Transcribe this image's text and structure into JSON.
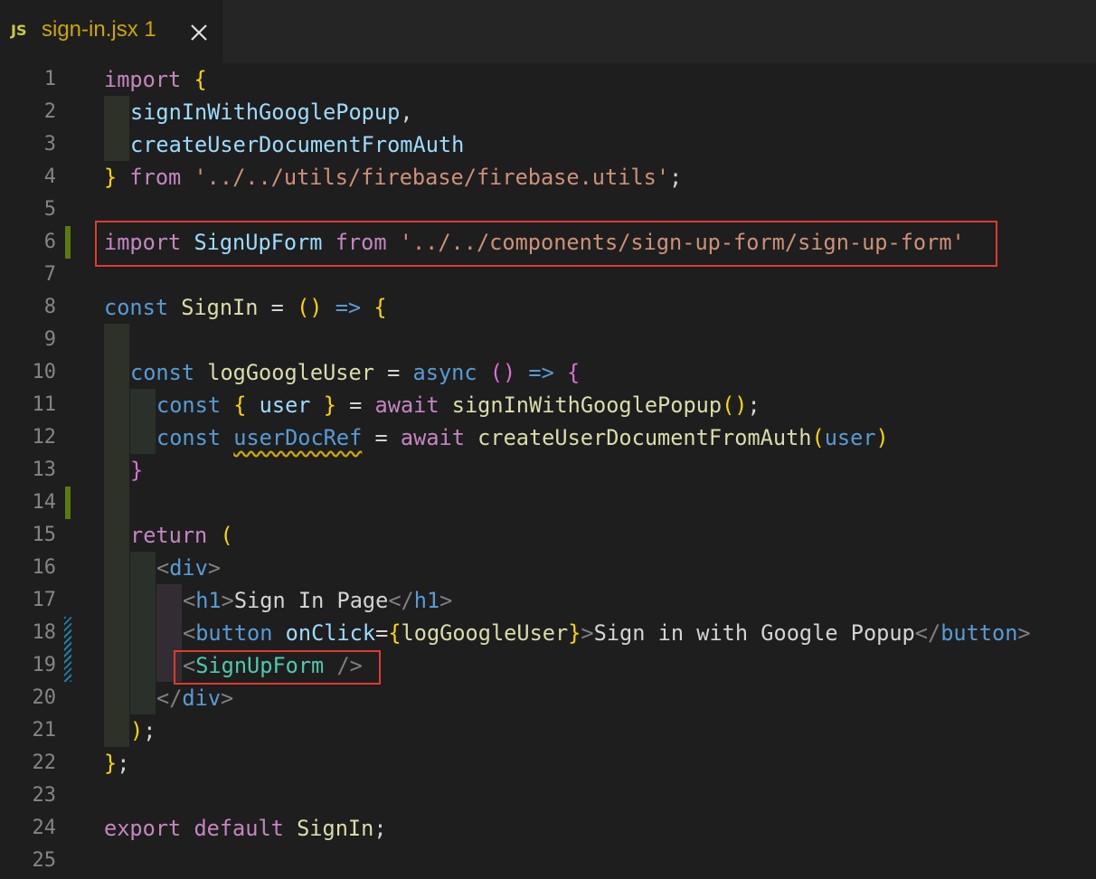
{
  "tab": {
    "icon": "JS",
    "filename": "sign-in.jsx",
    "problem_count": "1",
    "close_icon": "close-icon"
  },
  "editor": {
    "line_numbers": [
      "1",
      "2",
      "3",
      "4",
      "5",
      "6",
      "7",
      "8",
      "9",
      "10",
      "11",
      "12",
      "13",
      "14",
      "15",
      "16",
      "17",
      "18",
      "19",
      "20",
      "21",
      "22",
      "23",
      "24",
      "25"
    ],
    "line1": {
      "a": "import",
      "b": "{"
    },
    "line2": {
      "a": "signInWithGooglePopup",
      "b": ","
    },
    "line3": {
      "a": "createUserDocumentFromAuth"
    },
    "line4": {
      "a": "}",
      "b": " from ",
      "c": "'../../utils/firebase/firebase.utils'",
      "d": ";"
    },
    "line6": {
      "a": "import",
      "b": " SignUpForm",
      "c": " from ",
      "d": "'../../components/sign-up-form/sign-up-form'"
    },
    "line8": {
      "a": "const",
      "b": " SignIn",
      "c": " = ",
      "d": "()",
      "e": " =>",
      "f": " {"
    },
    "line10": {
      "a": "const",
      "b": " logGoogleUser",
      "c": " = ",
      "d": "async",
      "e": " ()",
      "f": " =>",
      "g": " {"
    },
    "line11": {
      "a": "const",
      "b": " {",
      "c": " user ",
      "d": "}",
      "e": " = ",
      "f": "await",
      "g": " signInWithGooglePopup",
      "h": "()",
      "i": ";"
    },
    "line12": {
      "a": "const",
      "b": " ",
      "c": "userDocRef",
      "d": " = ",
      "e": "await",
      "f": " createUserDocumentFromAuth",
      "g": "(",
      "h": "user",
      "i": ")"
    },
    "line13": {
      "a": "}"
    },
    "line15": {
      "a": "return",
      "b": " ("
    },
    "line16": {
      "a": "<",
      "b": "div",
      "c": ">"
    },
    "line17": {
      "a": "<",
      "b": "h1",
      "c": ">",
      "d": "Sign In Page",
      "e": "</",
      "f": "h1",
      "g": ">"
    },
    "line18": {
      "a": "<",
      "b": "button",
      "c": " onClick",
      "d": "=",
      "e": "{",
      "f": "logGoogleUser",
      "g": "}",
      "h": ">",
      "i": "Sign in with Google Popup",
      "j": "</",
      "k": "button",
      "l": ">"
    },
    "line19": {
      "a": "<",
      "b": "SignUpForm",
      "c": " />"
    },
    "line20": {
      "a": "</",
      "b": "div",
      "c": ">"
    },
    "line21": {
      "a": ")",
      "b": ";"
    },
    "line22": {
      "a": "}",
      "b": ";"
    },
    "line24": {
      "a": "export",
      "b": " default",
      "c": " SignIn",
      "d": ";"
    }
  },
  "colors": {
    "keyword": "#c586c0",
    "storage": "#569cd6",
    "function": "#dcdcaa",
    "variable": "#9cdcfe",
    "string": "#ce9178",
    "component": "#4ec9b0",
    "highlight_box": "#e03a2f"
  }
}
